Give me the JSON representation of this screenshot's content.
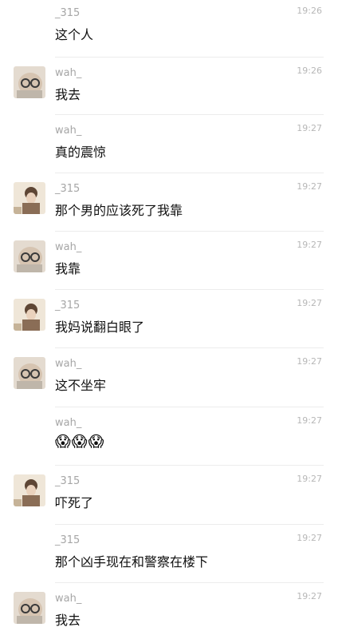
{
  "messages": [
    {
      "sender": "_315",
      "time": "19:26",
      "text": "这个人",
      "avatar": "none"
    },
    {
      "sender": "wah_",
      "time": "19:26",
      "text": "我去",
      "avatar": "wah"
    },
    {
      "sender": "wah_",
      "time": "19:27",
      "text": "真的震惊",
      "avatar": "none"
    },
    {
      "sender": "_315",
      "time": "19:27",
      "text": "那个男的应该死了我靠",
      "avatar": "315"
    },
    {
      "sender": "wah_",
      "time": "19:27",
      "text": "我靠",
      "avatar": "wah"
    },
    {
      "sender": "_315",
      "time": "19:27",
      "text": "我妈说翻白眼了",
      "avatar": "315"
    },
    {
      "sender": "wah_",
      "time": "19:27",
      "text": "这不坐牢",
      "avatar": "wah"
    },
    {
      "sender": "wah_",
      "time": "19:27",
      "text": "😱😱😱",
      "avatar": "none"
    },
    {
      "sender": "_315",
      "time": "19:27",
      "text": "吓死了",
      "avatar": "315"
    },
    {
      "sender": "_315",
      "time": "19:27",
      "text": "那个凶手现在和警察在楼下",
      "avatar": "none"
    },
    {
      "sender": "wah_",
      "time": "19:27",
      "text": "我去",
      "avatar": "wah"
    }
  ]
}
